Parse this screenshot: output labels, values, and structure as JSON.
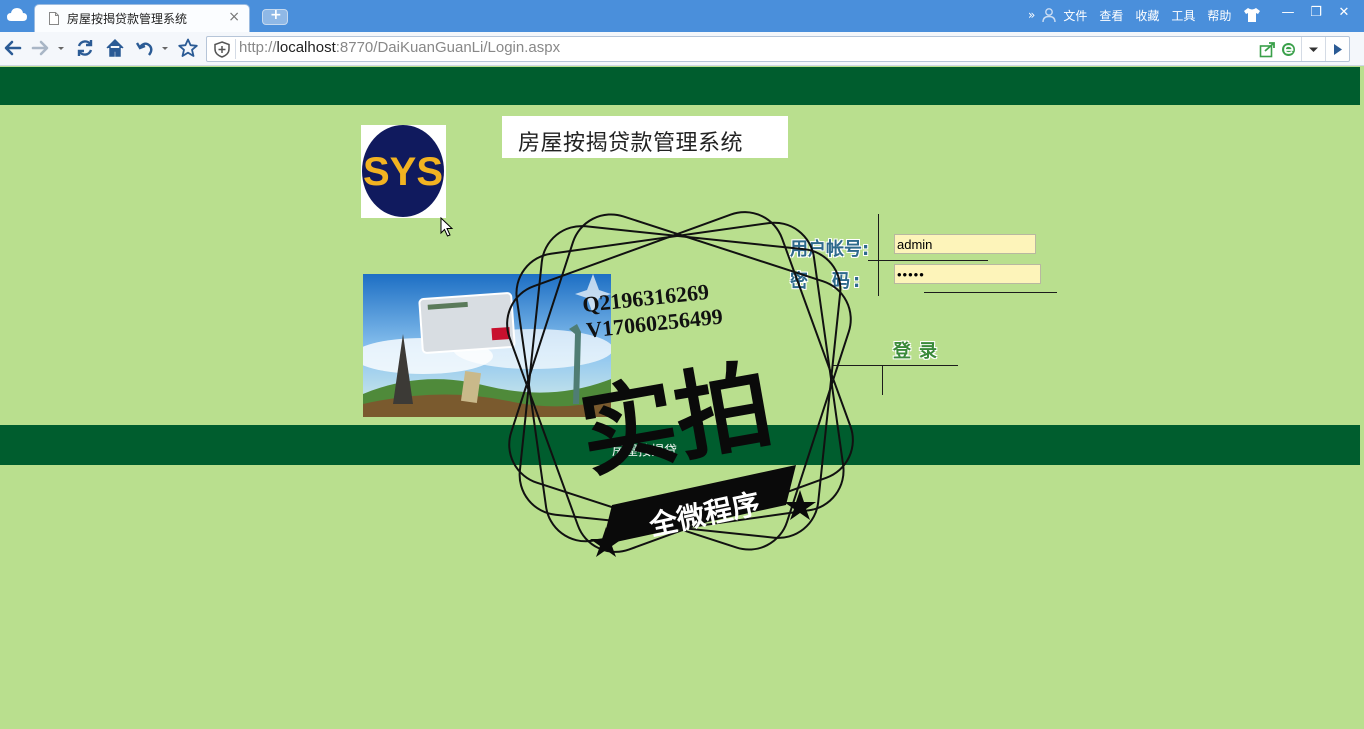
{
  "browser": {
    "tab_title": "房屋按揭贷款管理系统",
    "tab_close": "×",
    "new_tab": "+",
    "url_prefix": "http://",
    "url_host": "localhost",
    "url_rest": ":8770/DaiKuanGuanLi/Login.aspx",
    "menu": {
      "more": "»",
      "file": "文件",
      "view": "查看",
      "favorites": "收藏",
      "tools": "工具",
      "help": "帮助"
    },
    "window_controls": {
      "minimize": "—",
      "restore": "❐",
      "close": "✕"
    }
  },
  "page": {
    "title": "房屋按揭贷款管理系统",
    "username_label": "用户帐号:",
    "password_label": "密　码:",
    "username_value": "admin",
    "password_value": "•••••",
    "login_label": "登录",
    "footer_text": "房屋按揭贷",
    "logo_text": "SYS"
  },
  "watermark": {
    "line1": "Q2196316269",
    "line2": "V17060256499",
    "main": "实拍",
    "ribbon": "全微程序"
  },
  "colors": {
    "chrome_blue": "#4a8fdb",
    "page_bg": "#b9df8e",
    "band_green": "#005d2e",
    "input_bg": "#fdf4ba"
  }
}
